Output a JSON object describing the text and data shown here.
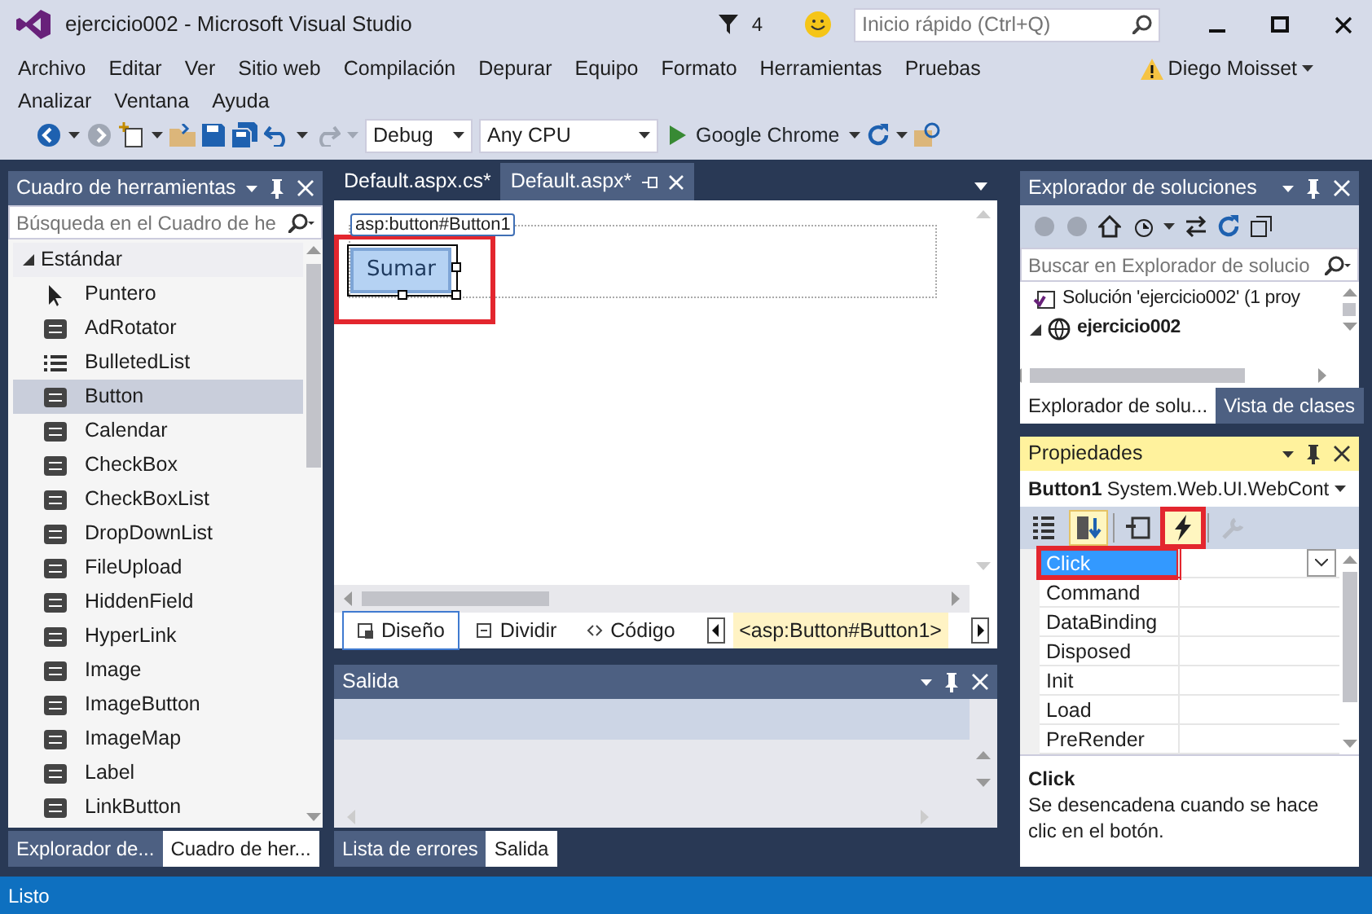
{
  "window": {
    "title": "ejercicio002 - Microsoft Visual Studio",
    "notifications": "4",
    "quick_launch": {
      "placeholder": "Inicio rápido (Ctrl+Q)"
    },
    "user": "Diego Moisset"
  },
  "menu": [
    "Archivo",
    "Editar",
    "Ver",
    "Sitio web",
    "Compilación",
    "Depurar",
    "Equipo",
    "Formato",
    "Herramientas",
    "Pruebas",
    "Analizar",
    "Ventana",
    "Ayuda"
  ],
  "toolbar": {
    "configuration": "Debug",
    "platform": "Any CPU",
    "run_target": "Google Chrome"
  },
  "toolbox": {
    "title": "Cuadro de herramientas",
    "search": {
      "placeholder": "Búsqueda en el Cuadro de he"
    },
    "group": {
      "label": "Estándar",
      "expanded": true
    },
    "items": [
      {
        "label": "Puntero",
        "selected": false
      },
      {
        "label": "AdRotator",
        "selected": false
      },
      {
        "label": "BulletedList",
        "selected": false
      },
      {
        "label": "Button",
        "selected": true
      },
      {
        "label": "Calendar",
        "selected": false
      },
      {
        "label": "CheckBox",
        "selected": false
      },
      {
        "label": "CheckBoxList",
        "selected": false
      },
      {
        "label": "DropDownList",
        "selected": false
      },
      {
        "label": "FileUpload",
        "selected": false
      },
      {
        "label": "HiddenField",
        "selected": false
      },
      {
        "label": "HyperLink",
        "selected": false
      },
      {
        "label": "Image",
        "selected": false
      },
      {
        "label": "ImageButton",
        "selected": false
      },
      {
        "label": "ImageMap",
        "selected": false
      },
      {
        "label": "Label",
        "selected": false
      },
      {
        "label": "LinkButton",
        "selected": false
      }
    ],
    "tabs": [
      {
        "label": "Explorador de...",
        "selected": false
      },
      {
        "label": "Cuadro de her...",
        "selected": true
      }
    ]
  },
  "editor": {
    "tabs": [
      {
        "label": "Default.aspx.cs*",
        "selected": false
      },
      {
        "label": "Default.aspx*",
        "selected": true
      }
    ],
    "control_tag": "asp:button#Button1",
    "control_text": "Sumar",
    "control_highlighted": true,
    "views": [
      {
        "label": "Diseño",
        "selected": true
      },
      {
        "label": "Dividir",
        "selected": false
      },
      {
        "label": "Código",
        "selected": false
      }
    ],
    "breadcrumb": "<asp:Button#Button1>"
  },
  "output": {
    "title": "Salida",
    "tabs": [
      {
        "label": "Lista de errores",
        "selected": false
      },
      {
        "label": "Salida",
        "selected": true
      }
    ]
  },
  "solution_explorer": {
    "title": "Explorador de soluciones",
    "search": {
      "placeholder": "Buscar en Explorador de solucio"
    },
    "tree": [
      {
        "label": "Solución 'ejercicio002'  (1 proy",
        "children": [
          {
            "label": "ejercicio002",
            "expanded": true
          }
        ]
      }
    ],
    "tabs": [
      {
        "label": "Explorador de solu...",
        "selected": true
      },
      {
        "label": "Vista de clases",
        "selected": false
      }
    ]
  },
  "properties": {
    "title": "Propiedades",
    "object_name": "Button1",
    "object_type": "System.Web.UI.WebCont",
    "toolbar": [
      {
        "kind": "categorized",
        "selected": false,
        "highlighted": false,
        "disabled": false
      },
      {
        "kind": "alphabetical",
        "selected": true,
        "highlighted": false,
        "disabled": false
      },
      {
        "kind": "properties",
        "selected": false,
        "highlighted": false,
        "disabled": false
      },
      {
        "kind": "events",
        "selected": true,
        "highlighted": true,
        "disabled": false
      },
      {
        "kind": "property-pages",
        "selected": false,
        "highlighted": false,
        "disabled": true
      }
    ],
    "events": [
      {
        "name": "Click",
        "selected": true,
        "highlighted": true
      },
      {
        "name": "Command",
        "selected": false,
        "highlighted": false
      },
      {
        "name": "DataBinding",
        "selected": false,
        "highlighted": false
      },
      {
        "name": "Disposed",
        "selected": false,
        "highlighted": false
      },
      {
        "name": "Init",
        "selected": false,
        "highlighted": false
      },
      {
        "name": "Load",
        "selected": false,
        "highlighted": false
      },
      {
        "name": "PreRender",
        "selected": false,
        "highlighted": false
      }
    ],
    "description": {
      "title": "Click",
      "text": "Se desencadena cuando se hace clic en el botón."
    }
  },
  "status_bar": "Listo"
}
